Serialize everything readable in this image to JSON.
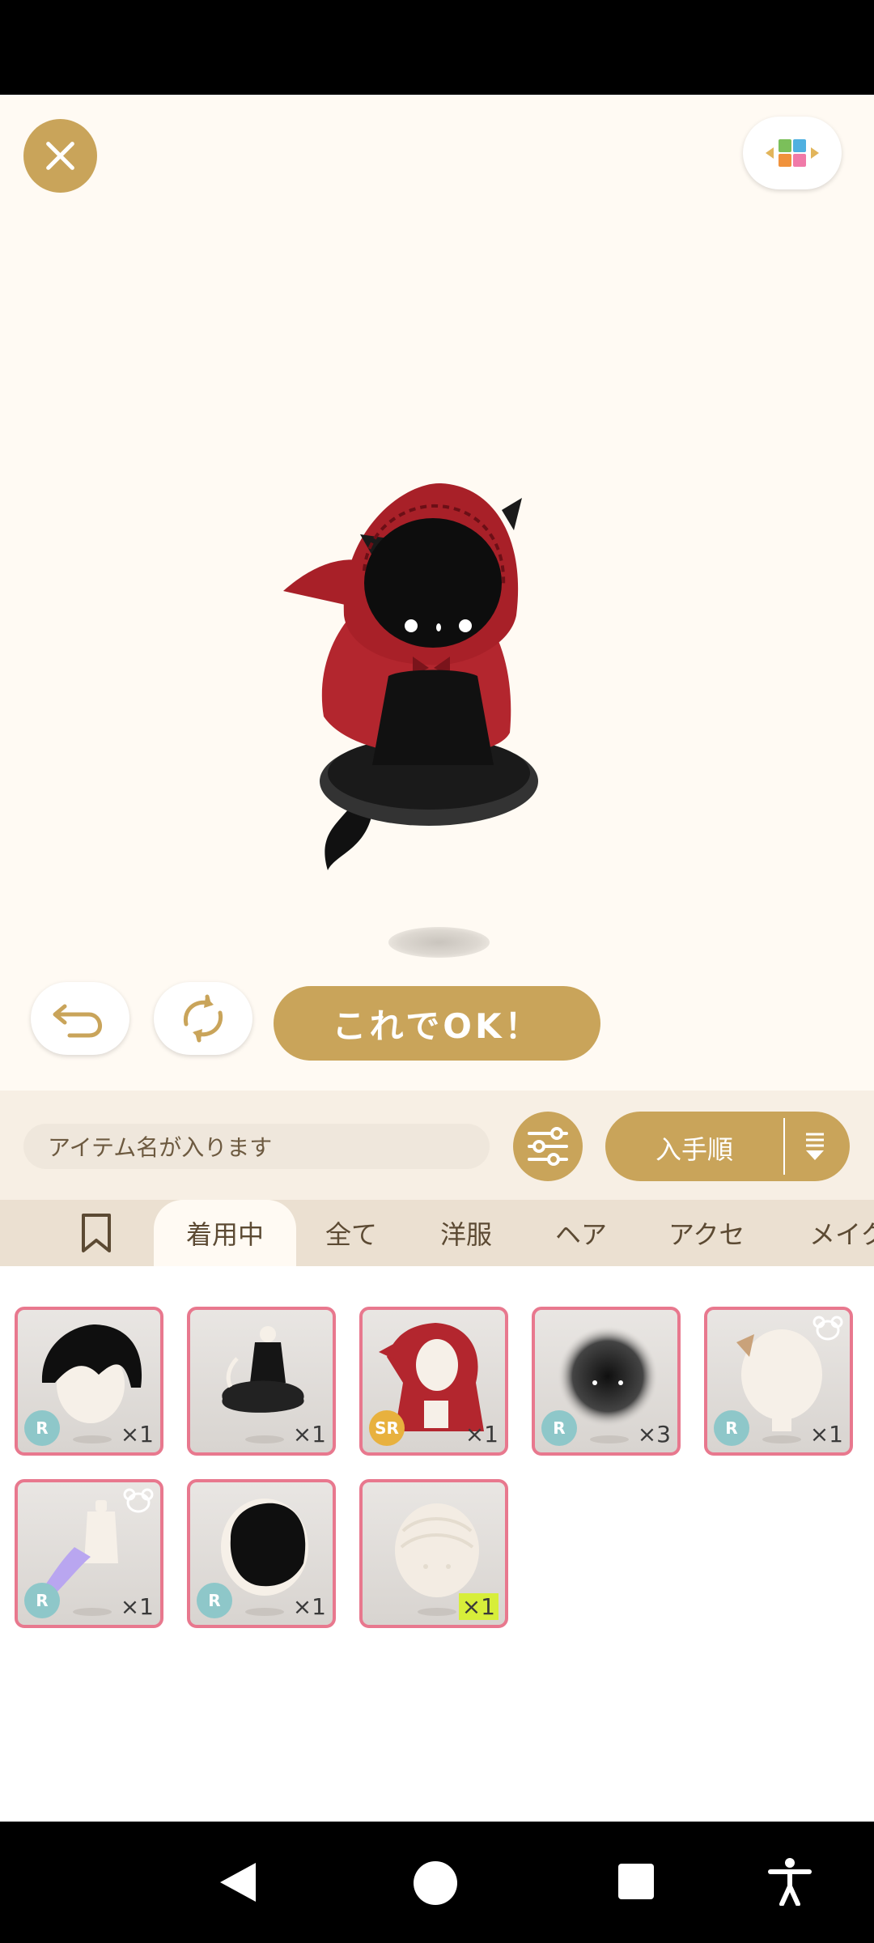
{
  "header": {
    "close_icon": "close-icon",
    "layout_icon": "layout-grid-icon"
  },
  "controls": {
    "undo_icon": "undo-icon",
    "rotate_icon": "rotate-icon",
    "ok_label": "これでOK！"
  },
  "toolbar": {
    "search_placeholder": "アイテム名が入ります",
    "filter_icon": "filter-sliders-icon",
    "sort_label": "入手順",
    "sort_icon": "sort-order-icon"
  },
  "tabs": [
    {
      "label": "",
      "icon": "bookmark-icon"
    },
    {
      "label": "着用中",
      "active": true
    },
    {
      "label": "全て"
    },
    {
      "label": "洋服"
    },
    {
      "label": "ヘア"
    },
    {
      "label": "アクセ"
    },
    {
      "label": "メイク"
    }
  ],
  "items": [
    {
      "kind": "black-bob-hair",
      "rarity": "R",
      "count": "×1",
      "bear": false
    },
    {
      "kind": "black-frill-dress",
      "rarity": "",
      "count": "×1",
      "bear": false
    },
    {
      "kind": "red-hood-cape",
      "rarity": "SR",
      "count": "×1",
      "bear": false
    },
    {
      "kind": "shadow-face",
      "rarity": "R",
      "count": "×3",
      "bear": false
    },
    {
      "kind": "cat-ear-accessory",
      "rarity": "R",
      "count": "×1",
      "bear": true
    },
    {
      "kind": "purple-trail-accessory",
      "rarity": "R",
      "count": "×1",
      "bear": true
    },
    {
      "kind": "black-hood-hair",
      "rarity": "R",
      "count": "×1",
      "bear": false
    },
    {
      "kind": "plain-head",
      "rarity": "",
      "count": "×1",
      "bear": false,
      "new": true
    }
  ],
  "navbar": {
    "back_icon": "back-triangle-icon",
    "home_icon": "home-circle-icon",
    "recents_icon": "recents-square-icon",
    "accessibility_icon": "accessibility-icon"
  },
  "colors": {
    "accent": "#c9a45a",
    "card_border": "#e8788e",
    "rarity_r": "#8ec7c9",
    "rarity_sr": "#e8b13e"
  }
}
